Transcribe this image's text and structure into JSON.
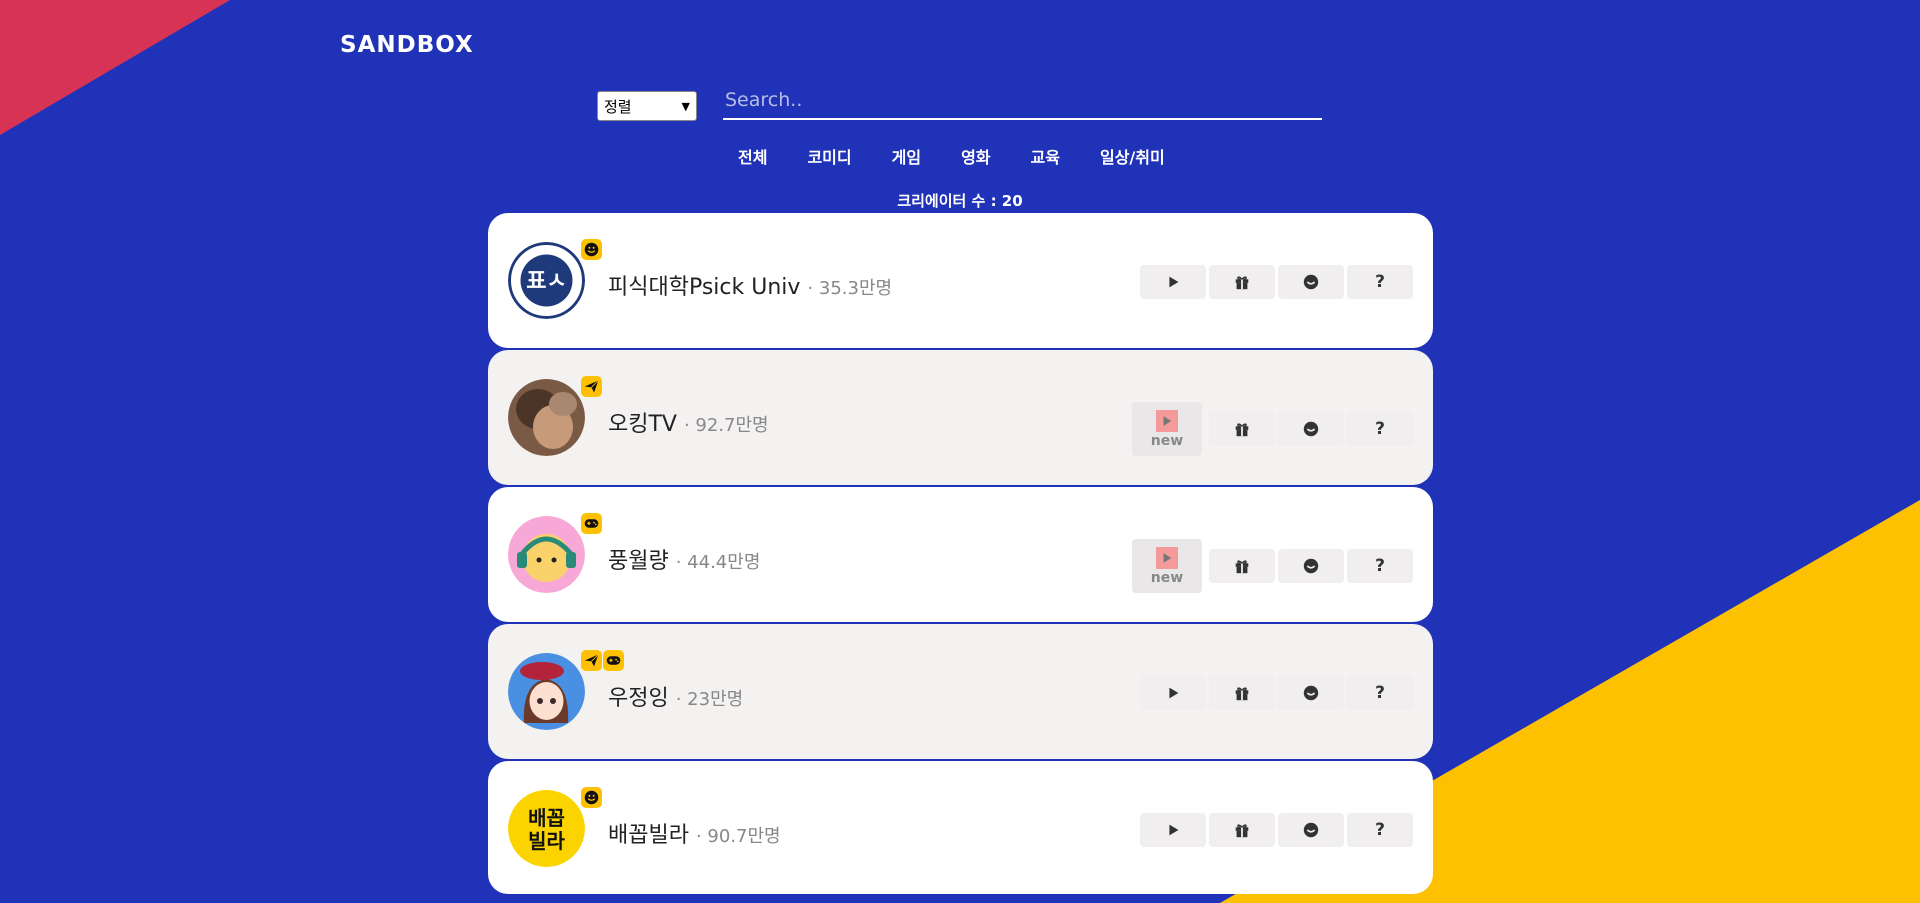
{
  "app": {
    "logo": "SANDBOX"
  },
  "search": {
    "sort_label": "정렬",
    "placeholder": "Search.."
  },
  "tabs": [
    "전체",
    "코미디",
    "게임",
    "영화",
    "교육",
    "일상/취미"
  ],
  "creator_count_label": "크리에이터 수 : 20",
  "creators": [
    {
      "name": "피식대학Psick Univ",
      "subscribers": "· 35.3만명",
      "badges": [
        "smile-icon"
      ],
      "new_video": false,
      "avatar": "psick-univ-logo"
    },
    {
      "name": "오킹TV",
      "subscribers": "· 92.7만명",
      "badges": [
        "paper-plane-icon"
      ],
      "new_video": true,
      "new_label": "new",
      "avatar": "person-photo"
    },
    {
      "name": "풍월량",
      "subscribers": "· 44.4만명",
      "badges": [
        "gamepad-icon"
      ],
      "new_video": true,
      "new_label": "new",
      "avatar": "cartoon-headphones"
    },
    {
      "name": "우정잉",
      "subscribers": "· 23만명",
      "badges": [
        "paper-plane-icon",
        "gamepad-icon"
      ],
      "new_video": false,
      "avatar": "cartoon-girl"
    },
    {
      "name": "배꼽빌라",
      "subscribers": "· 90.7만명",
      "badges": [
        "smile-icon"
      ],
      "new_video": false,
      "avatar": "baekkop-logo",
      "avatar_text": [
        "배꼽",
        "빌라"
      ]
    }
  ],
  "actions": {
    "help_label": "?"
  },
  "colors": {
    "background": "#2033b8",
    "accent_red": "#d63355",
    "accent_yellow": "#fec102"
  }
}
